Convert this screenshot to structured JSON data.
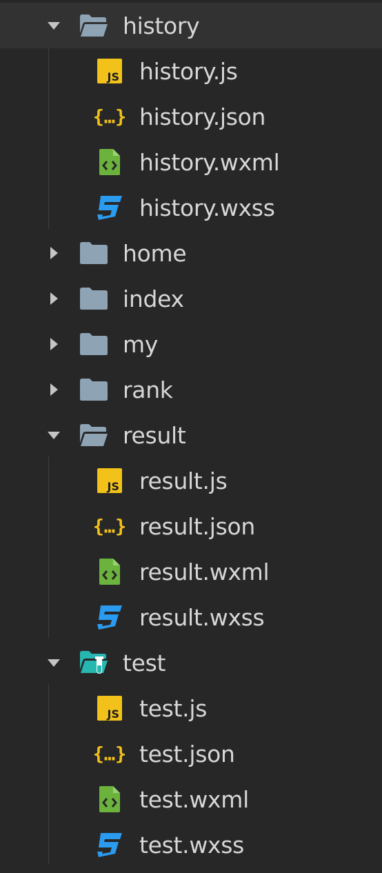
{
  "file_tree": {
    "colors": {
      "background": "#272727",
      "selected_row": "#323232",
      "text": "#d7d7d7",
      "folder": "#8ea3b4",
      "test_folder": "#27b7b1",
      "js_badge": "#f2c21b",
      "json_braces": "#f2c21b",
      "wxml": "#6cb33e",
      "wxss": "#2a9bef"
    },
    "items": [
      {
        "label": "history",
        "icon": "folder-open-icon",
        "expanded": true
      },
      {
        "label": "history.js",
        "icon": "js-file-icon"
      },
      {
        "label": "history.json",
        "icon": "json-file-icon"
      },
      {
        "label": "history.wxml",
        "icon": "wxml-file-icon"
      },
      {
        "label": "history.wxss",
        "icon": "wxss-file-icon"
      },
      {
        "label": "home",
        "icon": "folder-closed-icon",
        "expanded": false
      },
      {
        "label": "index",
        "icon": "folder-closed-icon",
        "expanded": false
      },
      {
        "label": "my",
        "icon": "folder-closed-icon",
        "expanded": false
      },
      {
        "label": "rank",
        "icon": "folder-closed-icon",
        "expanded": false
      },
      {
        "label": "result",
        "icon": "folder-open-icon",
        "expanded": true
      },
      {
        "label": "result.js",
        "icon": "js-file-icon"
      },
      {
        "label": "result.json",
        "icon": "json-file-icon"
      },
      {
        "label": "result.wxml",
        "icon": "wxml-file-icon"
      },
      {
        "label": "result.wxss",
        "icon": "wxss-file-icon"
      },
      {
        "label": "test",
        "icon": "test-folder-open-icon",
        "expanded": true
      },
      {
        "label": "test.js",
        "icon": "js-file-icon"
      },
      {
        "label": "test.json",
        "icon": "json-file-icon"
      },
      {
        "label": "test.wxml",
        "icon": "wxml-file-icon"
      },
      {
        "label": "test.wxss",
        "icon": "wxss-file-icon"
      }
    ]
  }
}
